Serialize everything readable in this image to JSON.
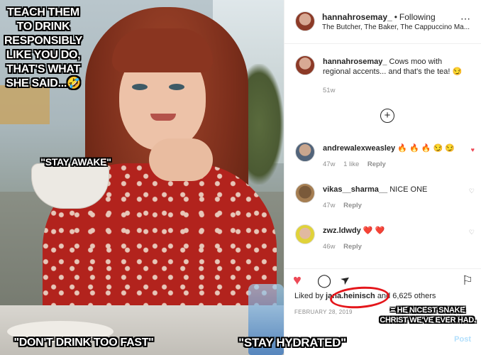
{
  "meme_text": {
    "top": "TEACH THEM TO DRINK RESPONSIBLY LIKE YOU DO, THAT'S WHAT SHE SAID...🤣",
    "stay_awake": "\"STAY AWAKE\"",
    "dont_drink_fast": "\"DON'T DRINK TOO FAST\"",
    "stay_hydrated": "\"STAY HYDRATED\"",
    "nicest_snake": "= HE NICEST SNAKE CHRIST WE'VE EVER HAD."
  },
  "post": {
    "username": "hannahrosemay_",
    "separator": "•",
    "follow_status": "Following",
    "location": "The Butcher, The Baker, The Cappuccino Ma...",
    "more_icon": "⋯",
    "caption": {
      "username": "hannahrosemay_",
      "text": "Cows moo with regional accents... and that's the tea! 😏",
      "time": "51w"
    },
    "load_more_icon": "+"
  },
  "comments": [
    {
      "username": "andrewalexweasley",
      "text": "🔥 🔥 🔥 😏 😏",
      "time": "47w",
      "likes": "1 like",
      "reply": "Reply",
      "liked": true
    },
    {
      "username": "vikas__sharma__",
      "text": "NICE ONE",
      "time": "47w",
      "likes": "",
      "reply": "Reply",
      "liked": false
    },
    {
      "username": "zwz.ldwdy",
      "text": "❤️ ❤️",
      "time": "46w",
      "likes": "",
      "reply": "Reply",
      "liked": false
    }
  ],
  "actions": {
    "like_icon": "♥",
    "comment_icon": "◯",
    "share_icon": "➤",
    "save_icon": "⚐"
  },
  "likes": {
    "prefix": "Liked by",
    "liker": "jana.heinisch",
    "suffix": "and 6,625 others"
  },
  "date": "FEBRUARY 28, 2019",
  "post_button": "Post"
}
